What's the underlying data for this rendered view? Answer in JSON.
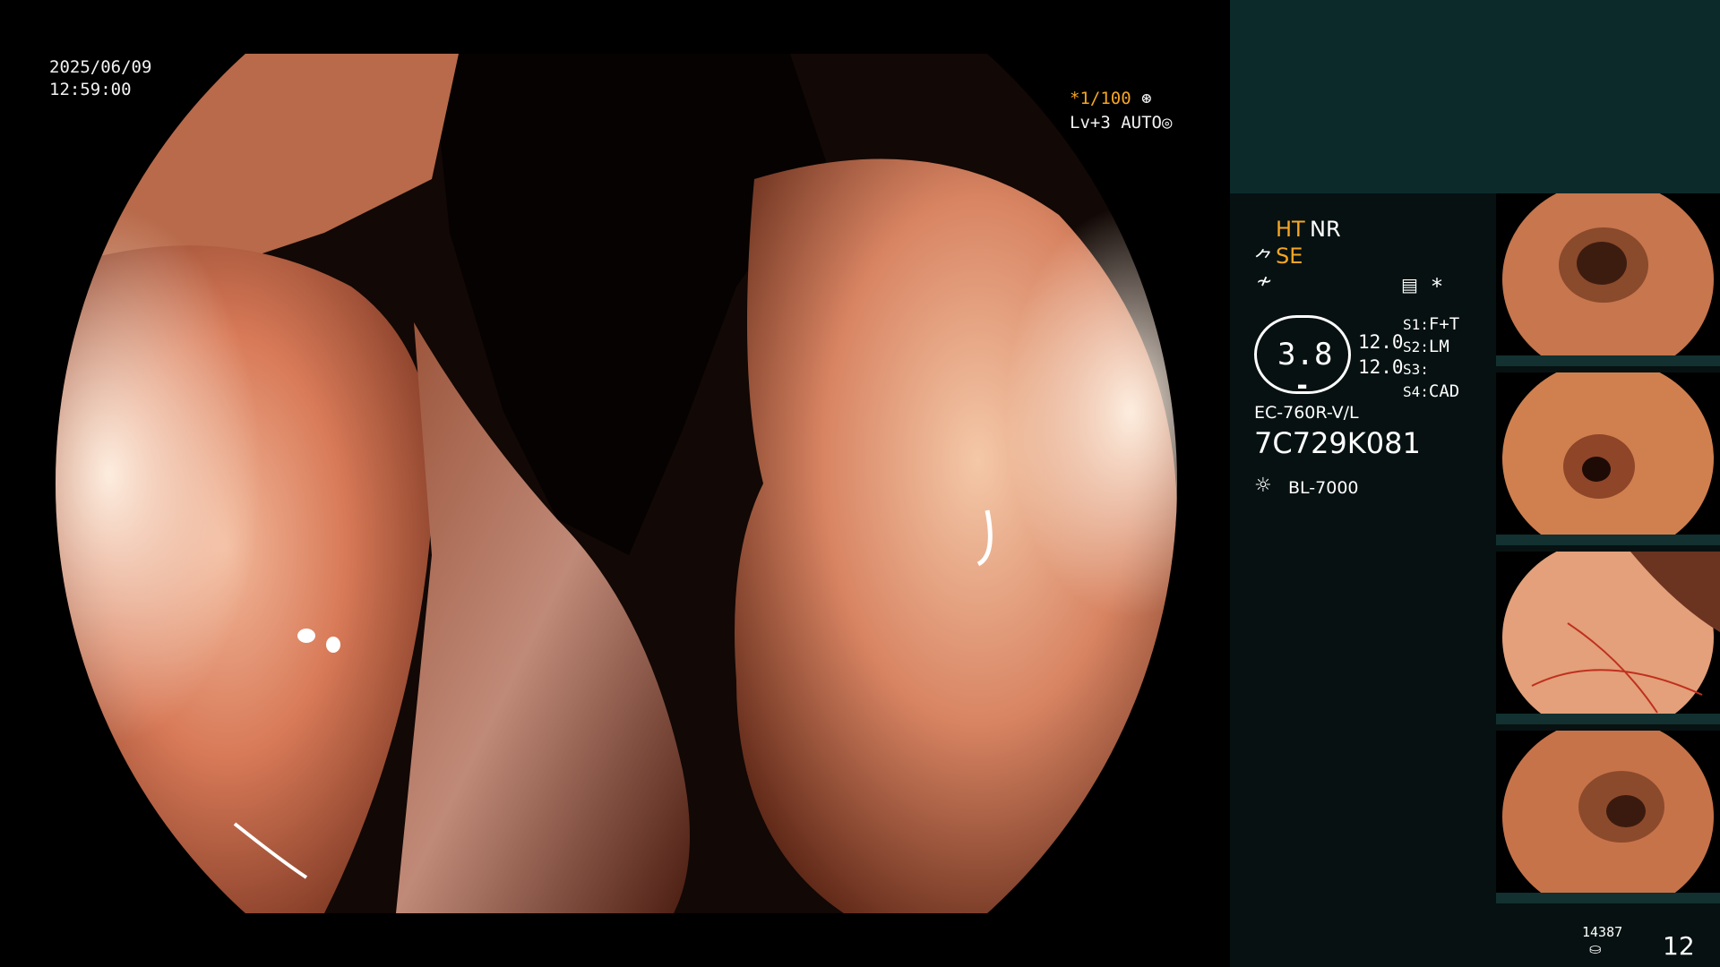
{
  "header": {
    "date": "2025/06/09",
    "time": "12:59:00",
    "shutter": "*1/100",
    "level": "Lv+3 AUTO"
  },
  "status": {
    "ht": "HT",
    "nr": "NR",
    "se": "SE",
    "zoom_value": "3.8",
    "val_1": "12.0",
    "val_2": "12.0",
    "switches": [
      {
        "key": "S1:",
        "value": "F+T"
      },
      {
        "key": "S2:",
        "value": "LM"
      },
      {
        "key": "S3:",
        "value": ""
      },
      {
        "key": "S4:",
        "value": "CAD"
      }
    ],
    "asterisk": "*",
    "scope_model": "EC-760R-V/L",
    "scope_serial": "7C729K081",
    "light_source": "BL-7000"
  },
  "storage": {
    "remaining": "14387",
    "image_count": "12"
  },
  "colors": {
    "sidebar_bg": "#071111",
    "sidebar_top": "#0d2a2b",
    "accent": "#f5a623"
  },
  "thumbnails": [
    {
      "label": "thumbnail-1"
    },
    {
      "label": "thumbnail-2"
    },
    {
      "label": "thumbnail-3"
    },
    {
      "label": "thumbnail-4"
    }
  ]
}
